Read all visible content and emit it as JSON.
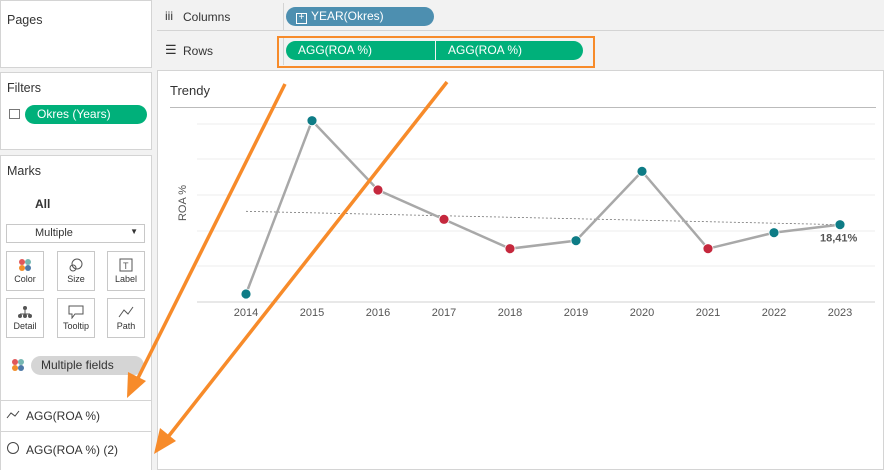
{
  "pages": {
    "title": "Pages"
  },
  "columns": {
    "label": "Columns",
    "pill": "YEAR(Okres)"
  },
  "rows": {
    "label": "Rows",
    "pills": [
      "AGG(ROA %)",
      "AGG(ROA %)"
    ]
  },
  "filters": {
    "title": "Filters",
    "pill": "Okres (Years)"
  },
  "marks": {
    "title": "Marks",
    "all_label": "All",
    "mark_type": "Multiple",
    "cards": [
      {
        "label": "Color",
        "icon": "color-icon"
      },
      {
        "label": "Size",
        "icon": "size-icon"
      },
      {
        "label": "Label",
        "icon": "label-icon"
      },
      {
        "label": "Detail",
        "icon": "detail-icon"
      },
      {
        "label": "Tooltip",
        "icon": "tooltip-icon"
      },
      {
        "label": "Path",
        "icon": "path-icon"
      }
    ],
    "fields_pill": "Multiple fields",
    "measure_rows": [
      "AGG(ROA %)",
      "AGG(ROA %) (2)"
    ]
  },
  "chart": {
    "title": "Trendy",
    "colors": {
      "up": "#0e7c86",
      "down": "#c5283d",
      "line": "#a8a8a8",
      "highlight": "#f78b2a"
    }
  },
  "chart_data": {
    "type": "line",
    "title": "Trendy",
    "xlabel": "",
    "ylabel": "ROA %",
    "x": [
      "2014",
      "2015",
      "2016",
      "2017",
      "2018",
      "2019",
      "2020",
      "2021",
      "2022",
      "2023"
    ],
    "series": [
      {
        "values": [
          10.3,
          16.8,
          14.2,
          13.1,
          12.0,
          12.3,
          14.9,
          12.0,
          12.6,
          12.9
        ],
        "direction": [
          "up",
          "up",
          "down",
          "down",
          "down",
          "up",
          "up",
          "down",
          "up",
          "up"
        ]
      }
    ],
    "trend_line": {
      "from": 13.4,
      "to": 12.9
    },
    "ylim": [
      10,
      17.2
    ],
    "grid": true,
    "data_labels": [
      {
        "x": "2023",
        "text": "18,41%"
      }
    ]
  }
}
